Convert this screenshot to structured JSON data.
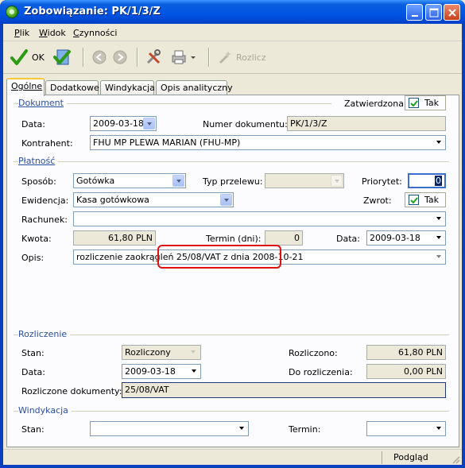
{
  "window": {
    "title": "Zobowiązanie: PK/1/3/Z"
  },
  "menu": [
    {
      "ul": "P",
      "rest": "lik"
    },
    {
      "ul": "W",
      "rest": "idok"
    },
    {
      "ul": "C",
      "rest": "zynności"
    }
  ],
  "toolbar": {
    "ok_label": "OK",
    "rozlicz_label": "Rozlicz"
  },
  "tabs": [
    "Ogólne",
    "Dodatkowe",
    "Windykacja",
    "Opis analityczny"
  ],
  "dokument": {
    "section": "Dokument",
    "zatwierdzona_label": "Zatwierdzona:",
    "zatwierdzona_value": "Tak",
    "data_label": "Data:",
    "data_value": "2009-03-18",
    "numer_label": "Numer dokumentu:",
    "numer_value": "PK/1/3/Z",
    "kontrahent_label": "Kontrahent:",
    "kontrahent_value": "FHU MP PLEWA MARIAN (FHU-MP)"
  },
  "platnosc": {
    "section": "Płatność",
    "sposob_label": "Sposób:",
    "sposob_value": "Gotówka",
    "typ_label": "Typ przelewu:",
    "typ_value": "",
    "priorytet_label": "Priorytet:",
    "priorytet_value": "0",
    "ewidencja_label": "Ewidencja:",
    "ewidencja_value": "Kasa gotówkowa",
    "zwrot_label": "Zwrot:",
    "zwrot_value": "Tak",
    "rachunek_label": "Rachunek:",
    "rachunek_value": "",
    "kwota_label": "Kwota:",
    "kwota_value": "61,80 PLN",
    "termin_label": "Termin (dni):",
    "termin_value": "0",
    "data_label": "Data:",
    "data_value": "2009-03-18",
    "opis_label": "Opis:",
    "opis_value": "rozliczenie zaokrągleń 25/08/VAT z dnia 2008-10-21"
  },
  "rozliczenie": {
    "section": "Rozliczenie",
    "stan_label": "Stan:",
    "stan_value": "Rozliczony",
    "rozliczono_label": "Rozliczono:",
    "rozliczono_value": "61,80 PLN",
    "data_label": "Data:",
    "data_value": "2009-03-18",
    "do_label": "Do rozliczenia:",
    "do_value": "0,00 PLN",
    "dokumenty_label": "Rozliczone dokumenty:",
    "dokumenty_value": "25/08/VAT"
  },
  "windykacja": {
    "section": "Windykacja",
    "stan_label": "Stan:",
    "stan_value": "",
    "termin_label": "Termin:",
    "termin_value": ""
  },
  "status": {
    "podglad": "Podgląd"
  }
}
